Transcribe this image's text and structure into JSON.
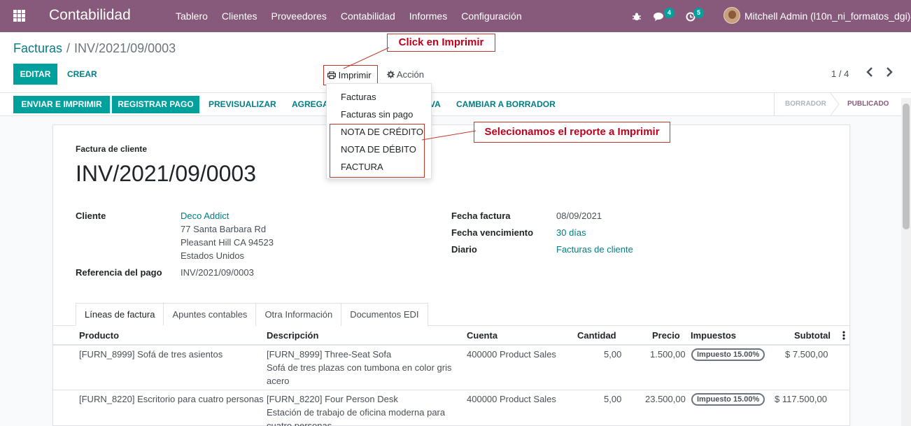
{
  "navbar": {
    "app_name": "Contabilidad",
    "menu": [
      "Tablero",
      "Clientes",
      "Proveedores",
      "Contabilidad",
      "Informes",
      "Configuración"
    ],
    "messages_count": "4",
    "activities_count": "5",
    "user": "Mitchell Admin (l10n_ni_formatos_dgi)"
  },
  "breadcrumb": {
    "parent": "Facturas",
    "separator": "/",
    "current": "INV/2021/09/0003"
  },
  "control": {
    "edit_label": "EDITAR",
    "create_label": "CREAR",
    "print_label": "Imprimir",
    "action_label": "Acción",
    "pager": "1 / 4"
  },
  "print_menu": {
    "items": [
      "Facturas",
      "Facturas sin pago",
      "NOTA DE CRÉDITO",
      "NOTA DE DÉBITO",
      "FACTURA"
    ]
  },
  "statusbar": {
    "buttons": [
      "ENVIAR E IMPRIMIR",
      "REGISTRAR PAGO",
      "PREVISUALIZAR",
      "AGREGAR NOTA",
      "A",
      "CAMBIAR A BORRADOR"
    ],
    "button_preview": "PREVISUALIZAR",
    "button_add_note_visible": "AGREGA",
    "button_hidden_tail": "VA",
    "button_to_draft": "CAMBIAR A BORRADOR",
    "states": [
      "BORRADOR",
      "PUBLICADO"
    ]
  },
  "form": {
    "type_label": "Factura de cliente",
    "number": "INV/2021/09/0003",
    "customer_label": "Cliente",
    "customer_name": "Deco Addict",
    "address": [
      "77 Santa Barbara Rd",
      "Pleasant Hill CA 94523",
      "Estados Unidos"
    ],
    "payment_ref_label": "Referencia del pago",
    "payment_ref": "INV/2021/09/0003",
    "invoice_date_label": "Fecha factura",
    "invoice_date": "08/09/2021",
    "due_date_label": "Fecha vencimiento",
    "due_date": "30 días",
    "journal_label": "Diario",
    "journal": "Facturas de cliente"
  },
  "tabs": [
    "Líneas de factura",
    "Apuntes contables",
    "Otra Información",
    "Documentos EDI"
  ],
  "table": {
    "headers": [
      "Producto",
      "Descripción",
      "Cuenta",
      "Cantidad",
      "Precio",
      "Impuestos",
      "Subtotal"
    ],
    "rows": [
      {
        "product": "[FURN_8999] Sofá de tres asientos",
        "description": [
          "[FURN_8999] Three-Seat Sofa",
          "Sofá de tres plazas con tumbona en color gris",
          "acero"
        ],
        "account": "400000 Product Sales",
        "qty": "5,00",
        "price": "1.500,00",
        "tax": "Impuesto 15.00%",
        "subtotal": "$ 7.500,00"
      },
      {
        "product": "[FURN_8220] Escritorio para cuatro personas",
        "description": [
          "[FURN_8220] Four Person Desk",
          "Estación de trabajo de oficina moderna para",
          "cuatro personas"
        ],
        "account": "400000 Product Sales",
        "qty": "5,00",
        "price": "23.500,00",
        "tax": "Impuesto 15.00%",
        "subtotal": "$ 117.500,00"
      }
    ]
  },
  "annotations": {
    "click_print": "Click en Imprimir",
    "select_report": "Selecionamos el reporte a Imprimir"
  },
  "colors": {
    "navbar": "#875A7B",
    "primary": "#00A09D",
    "link": "#017E84",
    "annotation": "#C0001A"
  }
}
